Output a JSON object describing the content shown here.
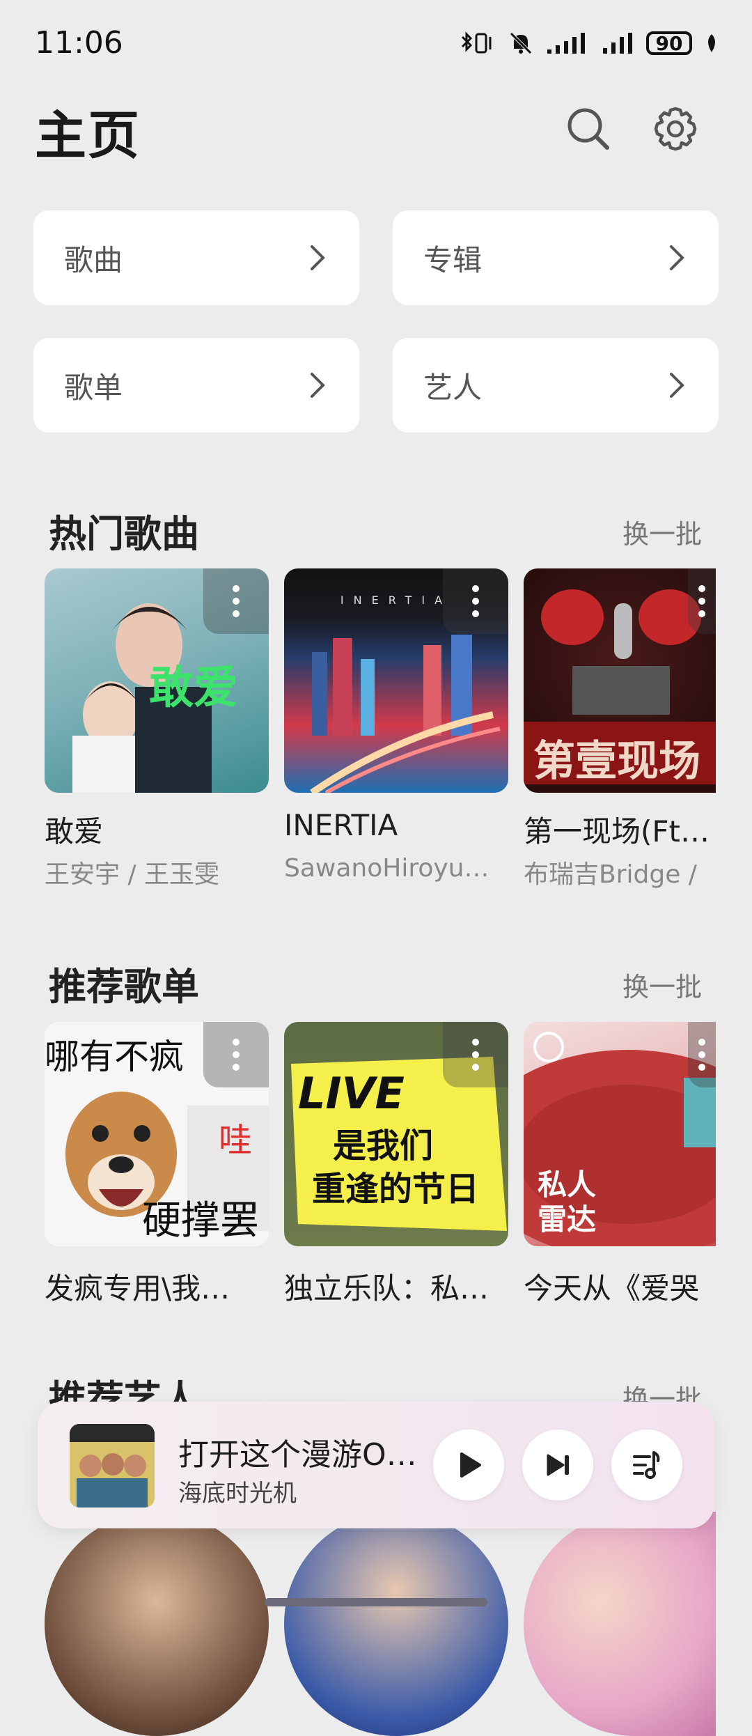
{
  "status": {
    "time": "11:06",
    "battery": "90"
  },
  "header": {
    "title": "主页"
  },
  "categories": [
    {
      "label": "歌曲"
    },
    {
      "label": "专辑"
    },
    {
      "label": "歌单"
    },
    {
      "label": "艺人"
    }
  ],
  "hot_songs": {
    "title": "热门歌曲",
    "refresh": "换一批",
    "items": [
      {
        "name": "敢爱",
        "artist": "王安宇 / 王玉雯",
        "cover_text": "敢爱"
      },
      {
        "name": "INERTIA",
        "artist": "SawanoHiroyu…",
        "cover_text": "INERTIA"
      },
      {
        "name": "第一现场(Ft…",
        "artist": "布瑞吉Bridge /",
        "cover_text": "第壹现场"
      }
    ]
  },
  "playlists": {
    "title": "推荐歌单",
    "refresh": "换一批",
    "items": [
      {
        "name": "发疯专用\\我…",
        "cover_top": "哪有不疯",
        "cover_mid": "哇",
        "cover_bottom": "硬撑罢"
      },
      {
        "name": "独立乐队：私…",
        "cover_line1": "LIVE",
        "cover_line2": "是我们",
        "cover_line3": "重逢的节日"
      },
      {
        "name": "今天从《爱哭",
        "cover_line1": "私人",
        "cover_line2": "雷达"
      }
    ]
  },
  "artists": {
    "title": "推荐艺人",
    "refresh": "换一批"
  },
  "now_playing": {
    "title": "打开这个漫游O…",
    "artist": "海底时光机"
  }
}
